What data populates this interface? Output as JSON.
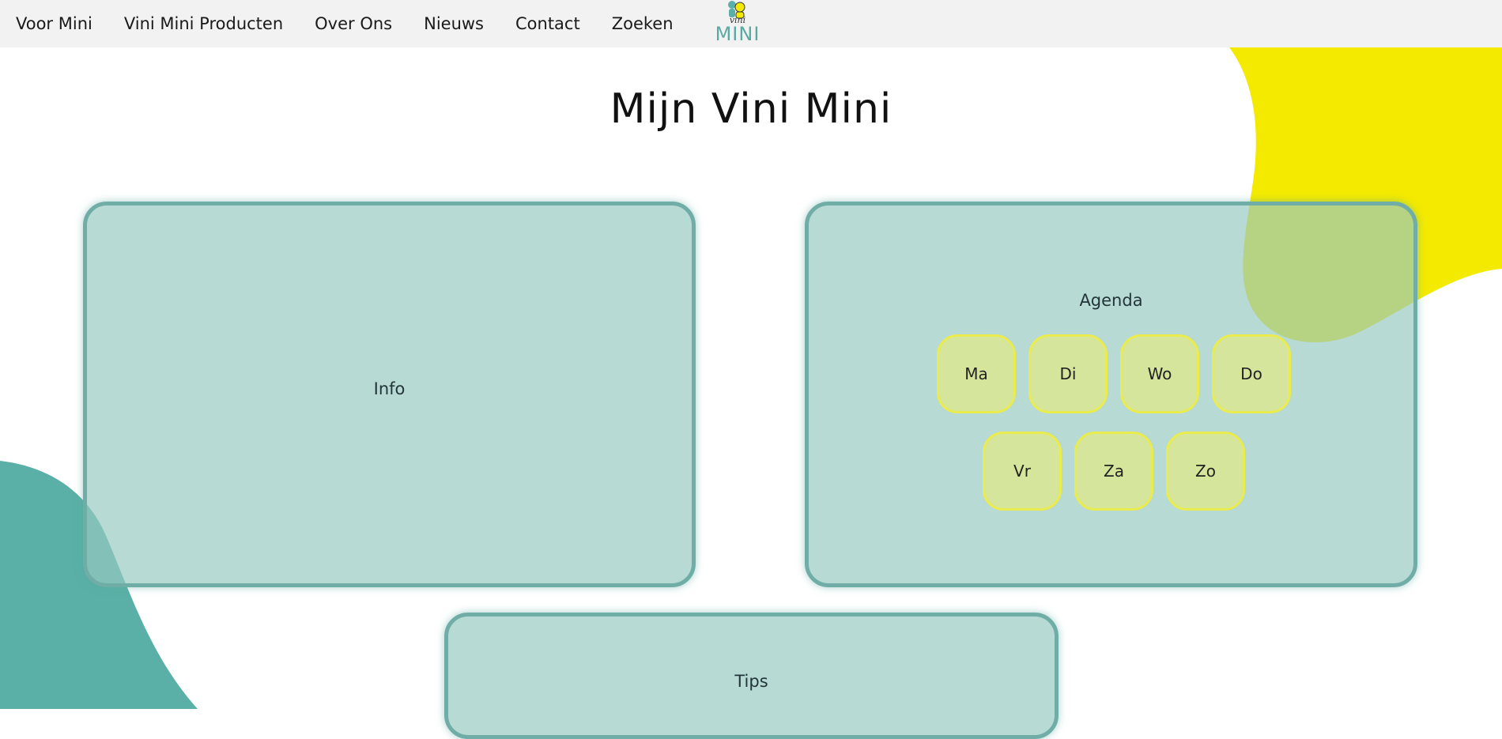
{
  "nav": {
    "items": [
      {
        "label": "Voor Mini"
      },
      {
        "label": "Vini Mini Producten"
      },
      {
        "label": "Over Ons"
      },
      {
        "label": "Nieuws"
      },
      {
        "label": "Contact"
      },
      {
        "label": "Zoeken"
      }
    ],
    "logo": {
      "small_text": "vini",
      "word": "MINI"
    }
  },
  "page_title": "Mijn Vini Mini",
  "cards": {
    "info": {
      "label": "Info"
    },
    "agenda": {
      "label": "Agenda",
      "days": [
        "Ma",
        "Di",
        "Wo",
        "Do",
        "Vr",
        "Za",
        "Zo"
      ]
    },
    "tips": {
      "label": "Tips"
    }
  },
  "colors": {
    "accent_teal": "#5aafa6",
    "accent_yellow": "#f4ea00",
    "card_border": "#6fada6",
    "nav_background": "#f2f2f2"
  }
}
